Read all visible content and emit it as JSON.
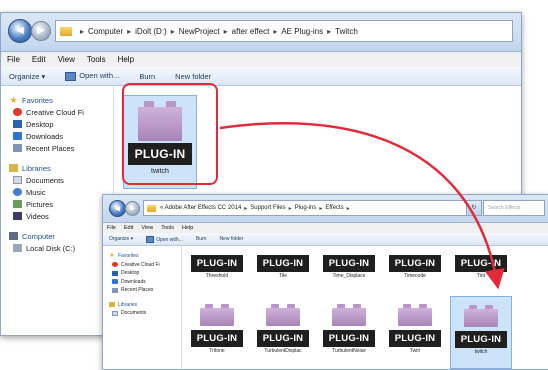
{
  "window1": {
    "address_path": [
      "Computer",
      "iDolt (D:)",
      "NewProject",
      "after effect",
      "AE Plug-ins",
      "Twitch"
    ],
    "menu": [
      "File",
      "Edit",
      "View",
      "Tools",
      "Help"
    ],
    "toolbar": {
      "organize": "Organize ▾",
      "open_with": "Open with...",
      "burn": "Burn",
      "new_folder": "New folder"
    },
    "nav": {
      "favorites": "Favorites",
      "creative_cloud": "Creative Cloud Fi",
      "desktop": "Desktop",
      "downloads": "Downloads",
      "recent": "Recent Places",
      "libraries": "Libraries",
      "documents": "Documents",
      "music": "Music",
      "pictures": "Pictures",
      "videos": "Videos",
      "computer": "Computer",
      "local_disk": "Local Disk (C:)"
    },
    "file": {
      "badge": "PLUG-IN",
      "name": "twitch"
    }
  },
  "window2": {
    "address_path": [
      "« Adobe After Effects CC 2014",
      "Support Files",
      "Plug-ins",
      "Effects"
    ],
    "search_placeholder": "Search Effects",
    "menu": [
      "File",
      "Edit",
      "View",
      "Tools",
      "Help"
    ],
    "toolbar": {
      "organize": "Organize ▾",
      "open_with": "Open with...",
      "burn": "Burn",
      "new_folder": "New folder"
    },
    "nav": {
      "favorites": "Favorites",
      "creative_cloud": "Creative Cloud Fi",
      "desktop": "Desktop",
      "downloads": "Downloads",
      "recent": "Recent Places",
      "libraries": "Libraries",
      "documents": "Documents"
    },
    "files_row1": [
      {
        "badge": "PLUG-IN",
        "name": "Threshold"
      },
      {
        "badge": "PLUG-IN",
        "name": "Tile"
      },
      {
        "badge": "PLUG-IN",
        "name": "Time_Displace"
      },
      {
        "badge": "PLUG-IN",
        "name": "Timecode"
      },
      {
        "badge": "PLUG-IN",
        "name": "Tint"
      }
    ],
    "files_row2": [
      {
        "badge": "PLUG-IN",
        "name": "Tritone"
      },
      {
        "badge": "PLUG-IN",
        "name": "TurbulentDisplac"
      },
      {
        "badge": "PLUG-IN",
        "name": "TurbulentNoise"
      },
      {
        "badge": "PLUG-IN",
        "name": "Twirl"
      },
      {
        "badge": "PLUG-IN",
        "name": "twitch"
      }
    ]
  },
  "colors": {
    "highlight": "#e22b3a",
    "arrow": "#e22b3a",
    "selection": "#cce3f9"
  }
}
